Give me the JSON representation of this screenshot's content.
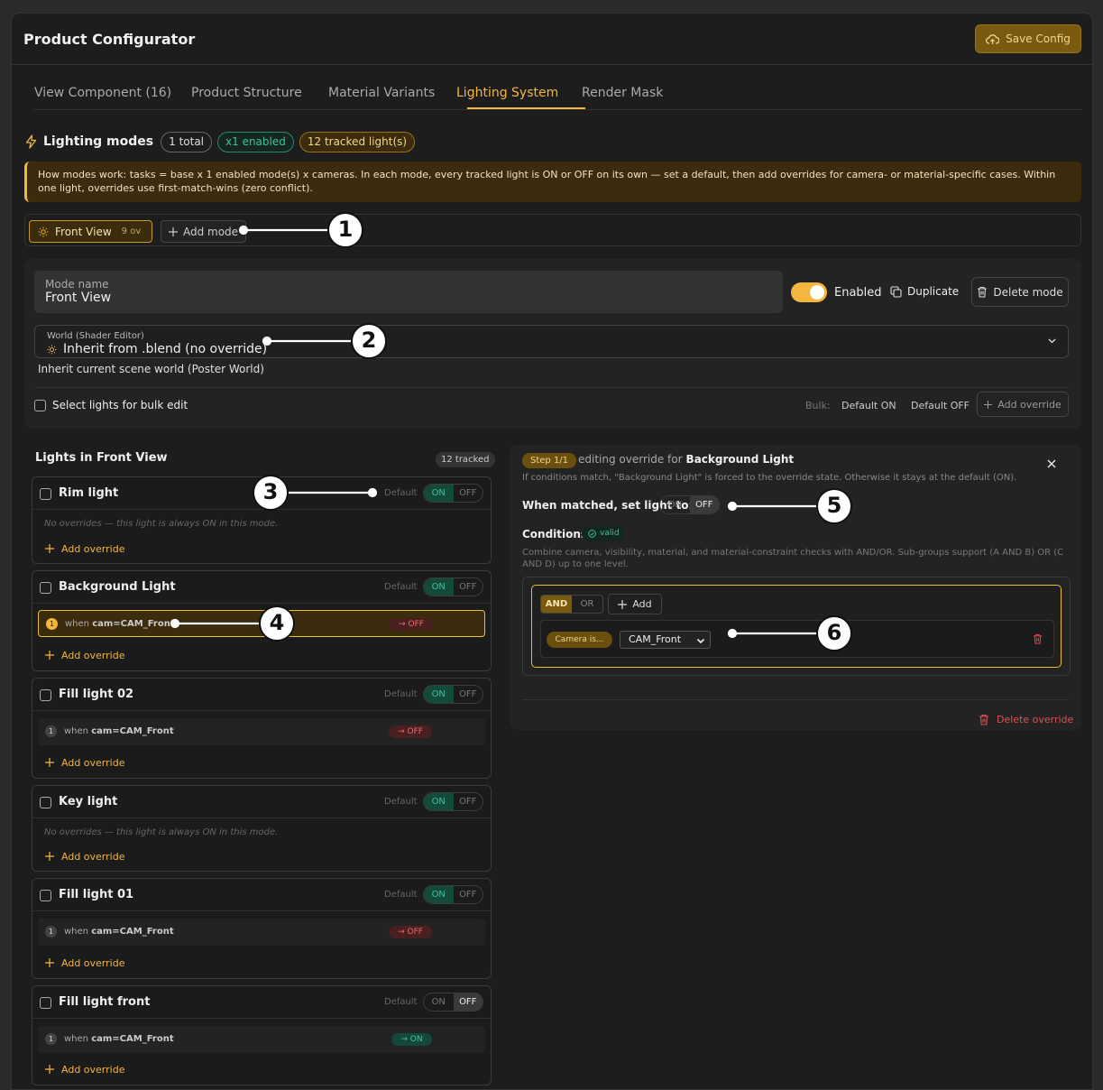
{
  "header": {
    "title": "Product Configurator",
    "save_label": "Save Config"
  },
  "tabs": [
    {
      "label": "View Component (16)"
    },
    {
      "label": "Product Structure"
    },
    {
      "label": "Material Variants"
    },
    {
      "label": "Lighting System",
      "active": true
    },
    {
      "label": "Render Mask"
    }
  ],
  "lighting": {
    "title": "Lighting modes",
    "total": "1 total",
    "enabled": "x1 enabled",
    "tracked": "12 tracked light(s)",
    "info": "How modes work: tasks = base x 1 enabled mode(s) x cameras. In each mode, every tracked light is ON or OFF on its own — set a default, then add overrides for camera- or material-specific cases. Within one light, overrides use first-match-wins (zero conflict)."
  },
  "modes": [
    {
      "name": "Front View",
      "count": "9 ov"
    }
  ],
  "add_mode_label": "Add mode",
  "mode_editor": {
    "name_label": "Mode name",
    "name_value": "Front View",
    "enabled_label": "Enabled",
    "duplicate_label": "Duplicate",
    "delete_label": "Delete mode",
    "world_label": "World (Shader Editor)",
    "world_value": "Inherit from .blend (no override)",
    "world_hint": "Inherit current scene world (Poster World)",
    "bulk_select_label": "Select lights for bulk edit",
    "bulk_label": "Bulk:",
    "bulk_on": "Default ON",
    "bulk_off": "Default OFF",
    "bulk_add": "Add override"
  },
  "lights_panel": {
    "title": "Lights in Front View",
    "tracked": "12 tracked"
  },
  "common": {
    "default_label": "Default",
    "on": "ON",
    "off": "OFF",
    "add_override": "Add override",
    "when": "when",
    "tag_off": "→ OFF",
    "tag_on": "→ ON"
  },
  "lights": [
    {
      "name": "Rim light",
      "default": "ON",
      "no_overrides": "No overrides — this light is always ON in this mode."
    },
    {
      "name": "Background Light",
      "default": "ON",
      "overrides": [
        {
          "num": "1",
          "cond": "cam=CAM_Front",
          "result": "OFF"
        }
      ]
    },
    {
      "name": "Fill light 02",
      "default": "ON",
      "overrides": [
        {
          "num": "1",
          "cond": "cam=CAM_Front",
          "result": "OFF"
        }
      ]
    },
    {
      "name": "Key light",
      "default": "ON",
      "no_overrides": "No overrides — this light is always ON in this mode."
    },
    {
      "name": "Fill light 01",
      "default": "ON",
      "overrides": [
        {
          "num": "1",
          "cond": "cam=CAM_Front",
          "result": "OFF"
        }
      ]
    },
    {
      "name": "Fill light front",
      "default": "OFF",
      "overrides": [
        {
          "num": "1",
          "cond": "cam=CAM_Front",
          "result": "ON"
        }
      ]
    }
  ],
  "detail": {
    "step": "Step 1/1",
    "editing_prefix": "editing override for",
    "light_name": "Background Light",
    "hint": "If conditions match, \"Background Light\" is forced to the override state. Otherwise it stays at the default (ON).",
    "when_matched": "When matched, set light to:",
    "matched_value": "OFF",
    "conditions_label": "Conditions",
    "valid": "valid",
    "conditions_hint": "Combine camera, visibility, material, and material-constraint checks with AND/OR. Sub-groups support (A AND B) OR (C AND D) up to one level.",
    "and": "AND",
    "or": "OR",
    "add": "Add",
    "camera_is": "Camera is...",
    "camera_value": "CAM_Front",
    "delete_override": "Delete override"
  },
  "callouts": [
    "1",
    "2",
    "3",
    "4",
    "5",
    "6"
  ],
  "colors": {
    "accent": "#f4b63d",
    "on_green": "#3fc29a",
    "off_red": "#f06c6c",
    "background": "#1d1d1d"
  }
}
